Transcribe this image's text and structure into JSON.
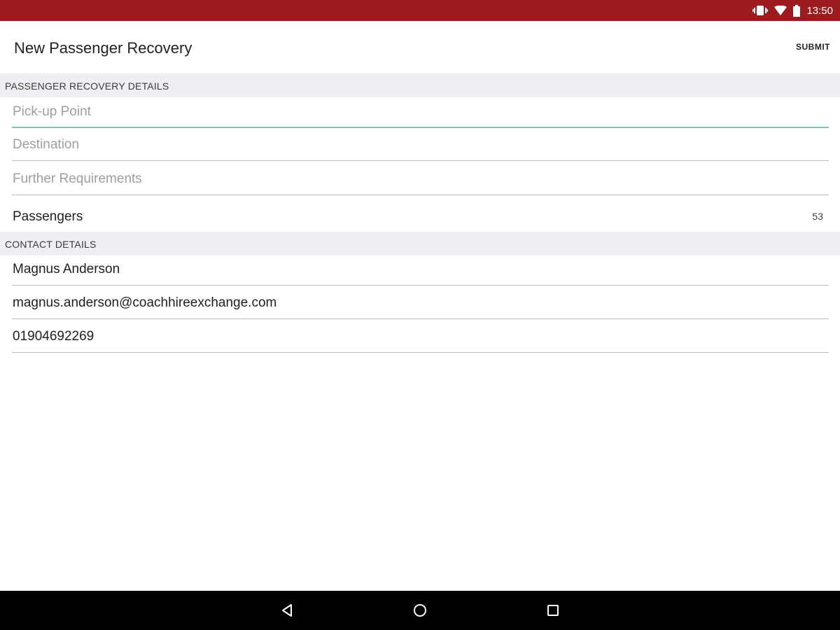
{
  "status_bar": {
    "time": "13:50",
    "icons": [
      "vibrate-icon",
      "wifi-icon",
      "battery-icon"
    ],
    "background_color": "#9b1b1f"
  },
  "toolbar": {
    "title": "New Passenger Recovery",
    "submit_label": "SUBMIT"
  },
  "passenger_recovery": {
    "header": "PASSENGER RECOVERY DETAILS",
    "pickup_placeholder": "Pick-up Point",
    "destination_placeholder": "Destination",
    "further_placeholder": "Further Requirements",
    "passengers_label": "Passengers",
    "passengers_count": "53"
  },
  "contact": {
    "header": "CONTACT DETAILS",
    "name": "Magnus Anderson",
    "email": "magnus.anderson@coachhireexchange.com",
    "phone": "01904692269"
  },
  "nav_bar": {
    "icons": [
      "back-icon",
      "home-icon",
      "recents-icon"
    ]
  },
  "colors": {
    "accent": "#7cc3ba",
    "section_background": "#eeeff2"
  }
}
